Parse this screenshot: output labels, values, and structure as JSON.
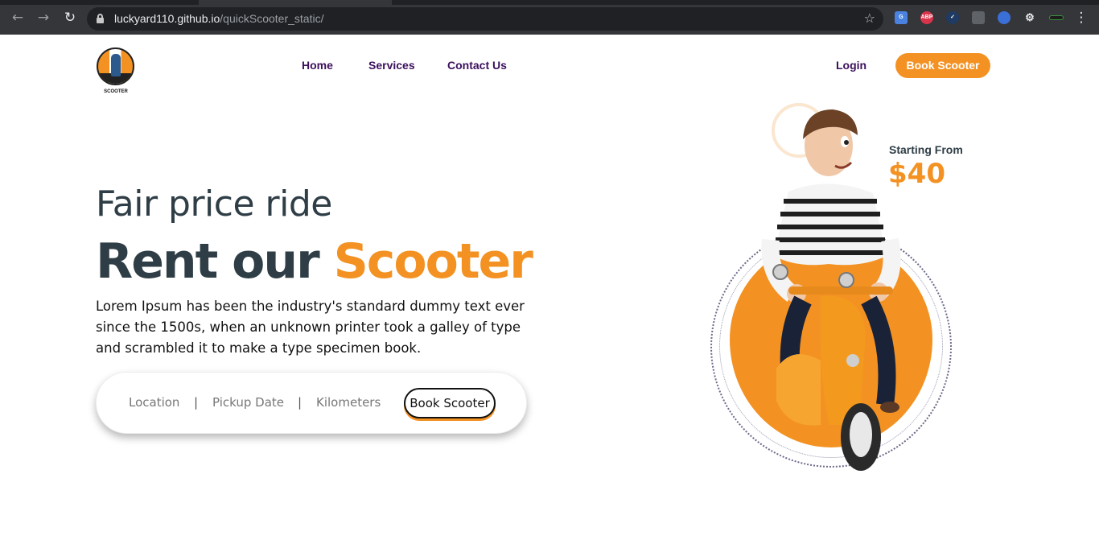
{
  "browser": {
    "url_host": "luckyard110.github.io",
    "url_path": "/quickScooter_static/",
    "extensions": [
      "google-translate-icon",
      "adblock-plus-icon",
      "checkmark-extension-icon",
      "puzzle-extension-icon",
      "globe-extension-icon",
      "extensions-puzzle-icon",
      "battery-extension-icon"
    ]
  },
  "header": {
    "logo_caption": "SCOOTER",
    "nav": [
      {
        "label": "Home"
      },
      {
        "label": "Services"
      },
      {
        "label": "Contact Us"
      }
    ],
    "login_label": "Login",
    "book_label": "Book Scooter"
  },
  "hero": {
    "subtitle": "Fair price ride",
    "title_prefix": "Rent our ",
    "title_accent": "Scooter",
    "description": "Lorem Ipsum has been the industry's standard dummy text ever since the 1500s, when an unknown printer took a galley of type and scrambled it to make a type specimen book.",
    "price_label": "Starting From",
    "price_value": "$40"
  },
  "booking_bar": {
    "location": "Location",
    "separator": "|",
    "pickup_date": "Pickup Date",
    "kilometers": "Kilometers",
    "book_label": "Book Scooter"
  },
  "colors": {
    "accent": "#f39223",
    "nav_text": "#3b0f5c",
    "heading": "#2f3e46"
  }
}
